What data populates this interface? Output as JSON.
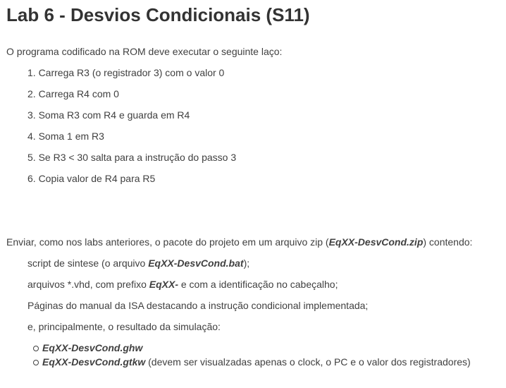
{
  "title": "Lab 6 - Desvios Condicionais (S11)",
  "intro": "O programa codificado na ROM deve executar o seguinte laço:",
  "steps": [
    "1. Carrega R3 (o registrador 3) com o valor 0",
    "2. Carrega R4 com 0",
    "3. Soma R3 com R4 e guarda em R4",
    "4. Soma 1 em R3",
    "5. Se R3 < 30 salta para a instrução do passo 3",
    "6. Copia valor de R4 para R5"
  ],
  "submit": {
    "text_before": "Enviar, como nos labs anteriores, o pacote do projeto em um arquivo zip (",
    "zip_name": "EqXX-DesvCond.zip",
    "text_after": ") contendo:"
  },
  "items": {
    "script_before": "script de sintese (o arquivo ",
    "script_name": "EqXX-DesvCond.bat",
    "script_after": ");",
    "vhd_before": "arquivos *.vhd, com prefixo ",
    "vhd_prefix": "EqXX-",
    "vhd_after": " e com a identificação no cabeçalho;",
    "manual": "Páginas do manual da ISA destacando a instrução condicional implementada;",
    "simulation": "e, principalmente, o resultado da simulação:"
  },
  "sim_files": {
    "ghw": "EqXX-DesvCond.ghw",
    "gtkw": "EqXX-DesvCond.gtkw",
    "gtkw_note": " (devem ser visualzadas apenas o clock, o PC e o valor dos registradores)"
  }
}
